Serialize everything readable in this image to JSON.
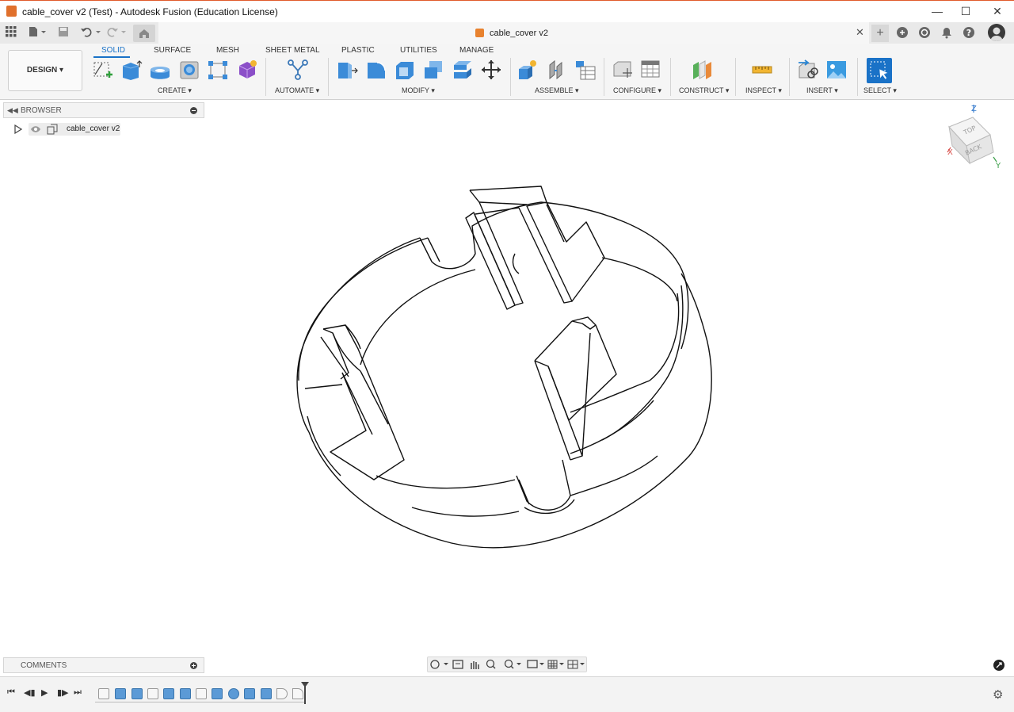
{
  "window": {
    "title": "cable_cover v2 (Test) - Autodesk Fusion (Education License)"
  },
  "tab": {
    "title": "cable_cover v2"
  },
  "ribbon": {
    "workspace": "DESIGN",
    "tabs": [
      "SOLID",
      "SURFACE",
      "MESH",
      "SHEET METAL",
      "PLASTIC",
      "UTILITIES",
      "MANAGE"
    ],
    "active_tab": "SOLID",
    "groups": [
      "CREATE",
      "AUTOMATE",
      "MODIFY",
      "ASSEMBLE",
      "CONFIGURE",
      "CONSTRUCT",
      "INSPECT",
      "INSERT",
      "SELECT"
    ]
  },
  "browser": {
    "header": "BROWSER",
    "root_component": "cable_cover v2"
  },
  "comments": {
    "header": "COMMENTS"
  },
  "viewcube": {
    "face_top": "TOP",
    "face_back": "BACK",
    "axis_z": "Z",
    "axis_x": "X",
    "axis_y": "Y"
  },
  "colors": {
    "accent": "#1a72c7",
    "feature_blue": "#5b9ad6",
    "app_orange": "#e0702c",
    "title_border": "#e05a2b"
  }
}
